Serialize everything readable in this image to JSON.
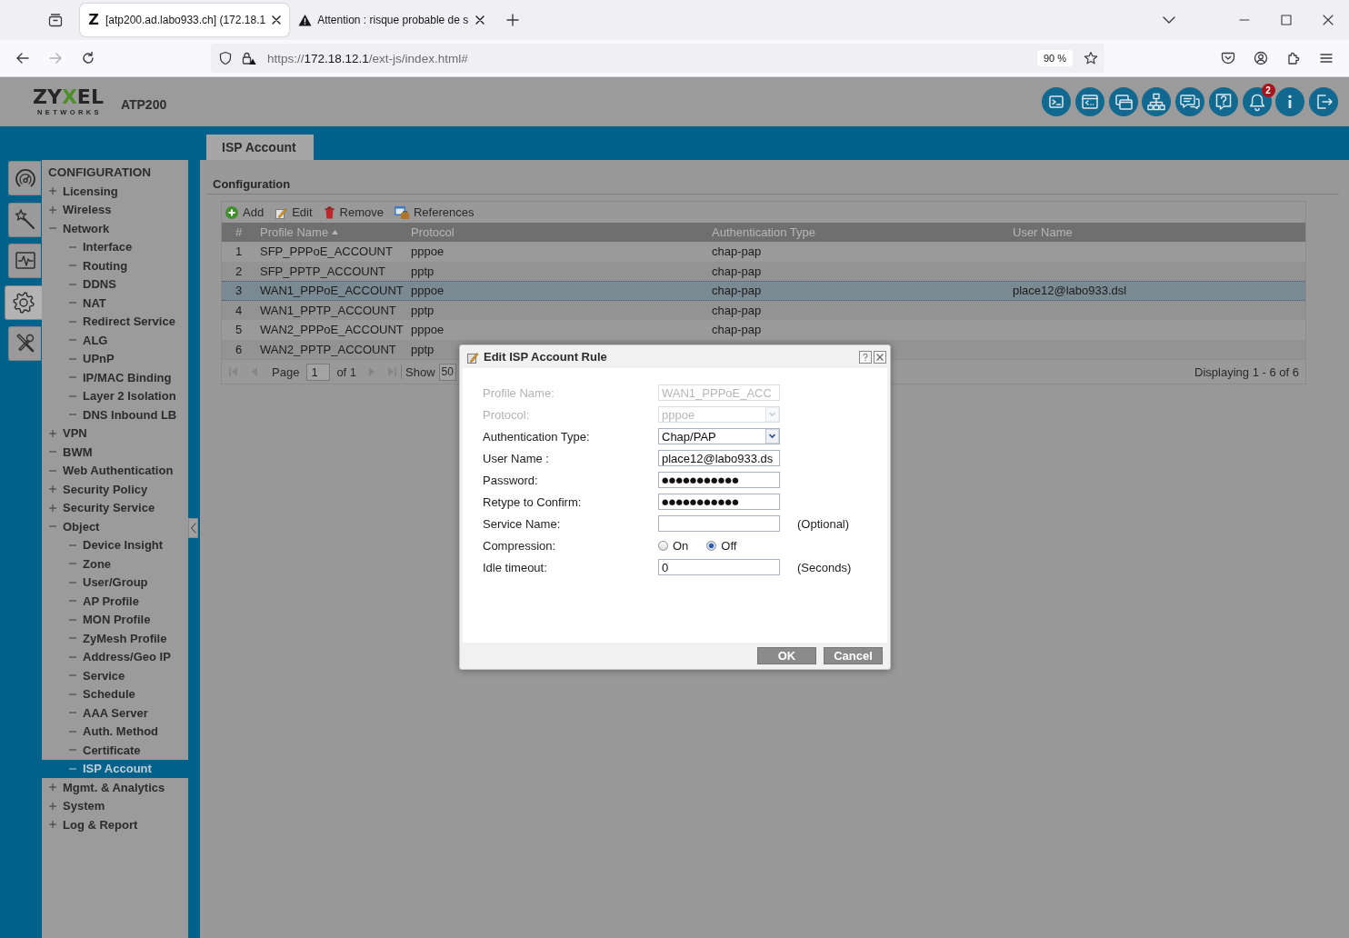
{
  "browser": {
    "nav_buttons": [
      {
        "kind": "back",
        "disabled": false
      },
      {
        "kind": "forward",
        "disabled": true
      },
      {
        "kind": "reload",
        "disabled": false
      }
    ],
    "tabs": [
      {
        "icon_text": "Z",
        "title": "[atp200.ad.labo933.ch] (172.18.1",
        "warning": false,
        "selected": true
      },
      {
        "title": "Attention : risque probable de s",
        "warning": true,
        "selected": false
      }
    ],
    "url": {
      "scheme": "https://",
      "host": "172.18.12.1",
      "path": "/ext-js/index.html#"
    },
    "zoom": "90 %"
  },
  "header": {
    "logo": {
      "parts": [
        {
          "text": "ZY",
          "accent": false
        },
        {
          "text": "X",
          "accent": true
        },
        {
          "text": "EL",
          "accent": false
        }
      ],
      "tagline": "NETWORKS"
    },
    "model": "ATP200",
    "badge": "2"
  },
  "sidebar": {
    "tabs": [
      {
        "kind": "gauge",
        "selected": false
      },
      {
        "kind": "wand",
        "selected": false
      },
      {
        "kind": "pulse",
        "selected": false
      },
      {
        "kind": "gear",
        "selected": true
      },
      {
        "kind": "tools",
        "selected": false
      }
    ],
    "menu": {
      "title": "CONFIGURATION",
      "items": [
        {
          "label": "Licensing",
          "kind": "folder",
          "expanded": false,
          "selected": false
        },
        {
          "label": "Wireless",
          "kind": "folder",
          "expanded": false,
          "selected": false
        },
        {
          "label": "Network",
          "kind": "folder",
          "expanded": true,
          "selected": false,
          "children": [
            {
              "label": "Interface",
              "selected": false
            },
            {
              "label": "Routing",
              "selected": false
            },
            {
              "label": "DDNS",
              "selected": false
            },
            {
              "label": "NAT",
              "selected": false
            },
            {
              "label": "Redirect Service",
              "selected": false
            },
            {
              "label": "ALG",
              "selected": false
            },
            {
              "label": "UPnP",
              "selected": false
            },
            {
              "label": "IP/MAC Binding",
              "selected": false
            },
            {
              "label": "Layer 2 Isolation",
              "selected": false
            },
            {
              "label": "DNS Inbound LB",
              "selected": false
            }
          ]
        },
        {
          "label": "VPN",
          "kind": "folder",
          "expanded": false,
          "selected": false
        },
        {
          "label": "BWM",
          "kind": "leaf",
          "selected": false
        },
        {
          "label": "Web Authentication",
          "kind": "leaf",
          "selected": false
        },
        {
          "label": "Security Policy",
          "kind": "folder",
          "expanded": false,
          "selected": false
        },
        {
          "label": "Security Service",
          "kind": "folder",
          "expanded": false,
          "selected": false
        },
        {
          "label": "Object",
          "kind": "folder",
          "expanded": true,
          "selected": false,
          "children": [
            {
              "label": "Device Insight",
              "selected": false
            },
            {
              "label": "Zone",
              "selected": false
            },
            {
              "label": "User/Group",
              "selected": false
            },
            {
              "label": "AP Profile",
              "selected": false
            },
            {
              "label": "MON Profile",
              "selected": false
            },
            {
              "label": "ZyMesh Profile",
              "selected": false
            },
            {
              "label": "Address/Geo IP",
              "selected": false
            },
            {
              "label": "Service",
              "selected": false
            },
            {
              "label": "Schedule",
              "selected": false
            },
            {
              "label": "AAA Server",
              "selected": false
            },
            {
              "label": "Auth. Method",
              "selected": false
            },
            {
              "label": "Certificate",
              "selected": false
            },
            {
              "label": "ISP Account",
              "selected": true
            }
          ]
        },
        {
          "label": "Mgmt. & Analytics",
          "kind": "folder",
          "expanded": false,
          "selected": false
        },
        {
          "label": "System",
          "kind": "folder",
          "expanded": false,
          "selected": false
        },
        {
          "label": "Log & Report",
          "kind": "folder",
          "expanded": false,
          "selected": false
        }
      ]
    }
  },
  "content": {
    "page_tab": "ISP Account",
    "section": "Configuration",
    "toolbar": [
      {
        "kind": "add",
        "label": "Add"
      },
      {
        "kind": "edit",
        "label": "Edit"
      },
      {
        "kind": "remove",
        "label": "Remove"
      },
      {
        "kind": "references",
        "label": "References"
      }
    ],
    "table": {
      "columns": [
        {
          "label": "#",
          "sorted": false
        },
        {
          "label": "Profile Name",
          "sorted": true
        },
        {
          "label": "Protocol",
          "sorted": false
        },
        {
          "label": "Authentication Type",
          "sorted": false
        },
        {
          "label": "User Name",
          "sorted": false
        }
      ],
      "rows": [
        {
          "cells": [
            "1",
            "SFP_PPPoE_ACCOUNT",
            "pppoe",
            "chap-pap"
          ],
          "selected": false
        },
        {
          "cells": [
            "2",
            "SFP_PPTP_ACCOUNT",
            "pptp",
            "chap-pap"
          ],
          "selected": false
        },
        {
          "cells": [
            "3",
            "WAN1_PPPoE_ACCOUNT",
            "pppoe",
            "chap-pap",
            "place12@labo933.dsl"
          ],
          "selected": true
        },
        {
          "cells": [
            "4",
            "WAN1_PPTP_ACCOUNT",
            "pptp",
            "chap-pap"
          ],
          "selected": false
        },
        {
          "cells": [
            "5",
            "WAN2_PPPoE_ACCOUNT",
            "pppoe",
            "chap-pap"
          ],
          "selected": false
        },
        {
          "cells": [
            "6",
            "WAN2_PPTP_ACCOUNT",
            "pptp"
          ],
          "selected": false
        }
      ]
    },
    "paging": {
      "buttons": [
        {
          "kind": "first",
          "disabled": true
        },
        {
          "kind": "prev",
          "disabled": true
        },
        {
          "kind": "next",
          "disabled": true
        },
        {
          "kind": "last",
          "disabled": true
        }
      ],
      "page_label": "Page",
      "page": "1",
      "page_count": "of 1",
      "show_label": "Show",
      "page_size": "50",
      "summary": "Displaying 1 - 6 of 6"
    }
  },
  "dialog": {
    "title": "Edit ISP Account Rule",
    "fields": [
      {
        "label": "Profile Name:",
        "kind": "text",
        "value": "WAN1_PPPoE_ACC",
        "disabled": true
      },
      {
        "label": "Protocol:",
        "kind": "select",
        "value": "pppoe",
        "disabled": true
      },
      {
        "label": "Authentication Type:",
        "kind": "select",
        "value": "Chap/PAP",
        "disabled": false
      },
      {
        "label": "User Name :",
        "kind": "text",
        "value": "place12@labo933.ds",
        "disabled": false
      },
      {
        "label": "Password:",
        "kind": "password",
        "value": "●●●●●●●●●●●",
        "disabled": false
      },
      {
        "label": "Retype to Confirm:",
        "kind": "password",
        "value": "●●●●●●●●●●●",
        "disabled": false
      },
      {
        "label": "Service Name:",
        "kind": "text",
        "disabled": false,
        "note": "(Optional)"
      },
      {
        "label": "Compression:",
        "kind": "radio",
        "disabled": false,
        "options": [
          {
            "label": "On",
            "selected": false
          },
          {
            "label": "Off",
            "selected": true
          }
        ]
      },
      {
        "label": "Idle timeout:",
        "kind": "text",
        "value": "0",
        "disabled": false,
        "note": "(Seconds)"
      }
    ],
    "buttons": [
      "OK",
      "Cancel"
    ]
  }
}
